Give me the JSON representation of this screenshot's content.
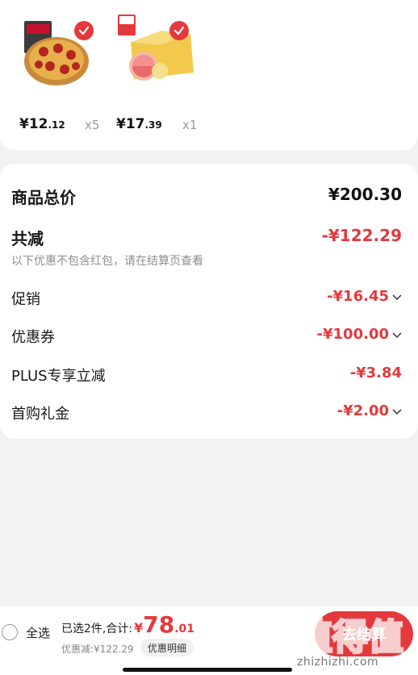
{
  "products": [
    {
      "name": "pizza",
      "price_main": "¥12",
      "price_cents": ".12",
      "qty": "x5"
    },
    {
      "name": "pomelo",
      "price_main": "¥17",
      "price_cents": ".39",
      "qty": "x1"
    }
  ],
  "summary": {
    "total_label": "商品总价",
    "total_value": "¥200.30",
    "reduce_label": "共减",
    "reduce_value": "-¥122.29",
    "note": "以下优惠不包含红包，请在结算页查看",
    "promo_label": "促销",
    "promo_value": "-¥16.45",
    "coupon_label": "优惠券",
    "coupon_value": "-¥100.00",
    "plus_label": "PLUS专享立减",
    "plus_value": "-¥3.84",
    "first_label": "首购礼金",
    "first_value": "-¥2.00"
  },
  "bottom": {
    "select_all": "全选",
    "selected_text": "已选2件,合计:",
    "yen": "¥",
    "total_int": "78",
    "total_cents": ".01",
    "discount": "优惠减:¥122.29",
    "detail_btn": "优惠明细",
    "checkout_btn": "去结算"
  },
  "watermark": {
    "text": "值得值",
    "url": "zhizhizhi.com"
  },
  "colors": {
    "accent": "#e4393c",
    "background": "#f2f2f2"
  }
}
